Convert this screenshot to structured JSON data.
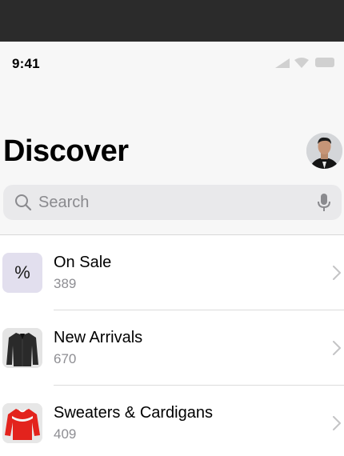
{
  "status_bar": {
    "time": "9:41",
    "icons": [
      "signal-icon",
      "wifi-icon",
      "battery-icon"
    ]
  },
  "header": {
    "title": "Discover",
    "avatar": "profile-avatar"
  },
  "search": {
    "placeholder": "Search",
    "icons": [
      "search-icon",
      "microphone-icon"
    ]
  },
  "categories": [
    {
      "title": "On Sale",
      "count": "389",
      "thumb_glyph": "%",
      "thumb_color": "#e2dfee"
    },
    {
      "title": "New Arrivals",
      "count": "670",
      "thumb": "dark-shirt-image"
    },
    {
      "title": "Sweaters & Cardigans",
      "count": "409",
      "thumb": "red-sweater-image"
    }
  ],
  "colors": {
    "top_bar": "#2b2b2b",
    "header_background": "#f7f7f7",
    "search_background": "#e9e9eb",
    "secondary_text": "#8e8e93",
    "sale_thumb": "#e2dfee"
  }
}
